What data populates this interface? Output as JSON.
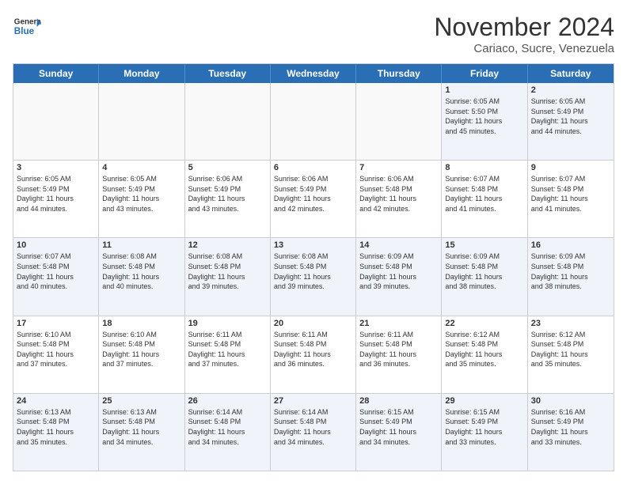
{
  "logo": {
    "general": "General",
    "blue": "Blue"
  },
  "title": "November 2024",
  "subtitle": "Cariaco, Sucre, Venezuela",
  "days": [
    "Sunday",
    "Monday",
    "Tuesday",
    "Wednesday",
    "Thursday",
    "Friday",
    "Saturday"
  ],
  "rows": [
    [
      {
        "day": "",
        "info": ""
      },
      {
        "day": "",
        "info": ""
      },
      {
        "day": "",
        "info": ""
      },
      {
        "day": "",
        "info": ""
      },
      {
        "day": "",
        "info": ""
      },
      {
        "day": "1",
        "info": "Sunrise: 6:05 AM\nSunset: 5:50 PM\nDaylight: 11 hours\nand 45 minutes."
      },
      {
        "day": "2",
        "info": "Sunrise: 6:05 AM\nSunset: 5:49 PM\nDaylight: 11 hours\nand 44 minutes."
      }
    ],
    [
      {
        "day": "3",
        "info": "Sunrise: 6:05 AM\nSunset: 5:49 PM\nDaylight: 11 hours\nand 44 minutes."
      },
      {
        "day": "4",
        "info": "Sunrise: 6:05 AM\nSunset: 5:49 PM\nDaylight: 11 hours\nand 43 minutes."
      },
      {
        "day": "5",
        "info": "Sunrise: 6:06 AM\nSunset: 5:49 PM\nDaylight: 11 hours\nand 43 minutes."
      },
      {
        "day": "6",
        "info": "Sunrise: 6:06 AM\nSunset: 5:49 PM\nDaylight: 11 hours\nand 42 minutes."
      },
      {
        "day": "7",
        "info": "Sunrise: 6:06 AM\nSunset: 5:48 PM\nDaylight: 11 hours\nand 42 minutes."
      },
      {
        "day": "8",
        "info": "Sunrise: 6:07 AM\nSunset: 5:48 PM\nDaylight: 11 hours\nand 41 minutes."
      },
      {
        "day": "9",
        "info": "Sunrise: 6:07 AM\nSunset: 5:48 PM\nDaylight: 11 hours\nand 41 minutes."
      }
    ],
    [
      {
        "day": "10",
        "info": "Sunrise: 6:07 AM\nSunset: 5:48 PM\nDaylight: 11 hours\nand 40 minutes."
      },
      {
        "day": "11",
        "info": "Sunrise: 6:08 AM\nSunset: 5:48 PM\nDaylight: 11 hours\nand 40 minutes."
      },
      {
        "day": "12",
        "info": "Sunrise: 6:08 AM\nSunset: 5:48 PM\nDaylight: 11 hours\nand 39 minutes."
      },
      {
        "day": "13",
        "info": "Sunrise: 6:08 AM\nSunset: 5:48 PM\nDaylight: 11 hours\nand 39 minutes."
      },
      {
        "day": "14",
        "info": "Sunrise: 6:09 AM\nSunset: 5:48 PM\nDaylight: 11 hours\nand 39 minutes."
      },
      {
        "day": "15",
        "info": "Sunrise: 6:09 AM\nSunset: 5:48 PM\nDaylight: 11 hours\nand 38 minutes."
      },
      {
        "day": "16",
        "info": "Sunrise: 6:09 AM\nSunset: 5:48 PM\nDaylight: 11 hours\nand 38 minutes."
      }
    ],
    [
      {
        "day": "17",
        "info": "Sunrise: 6:10 AM\nSunset: 5:48 PM\nDaylight: 11 hours\nand 37 minutes."
      },
      {
        "day": "18",
        "info": "Sunrise: 6:10 AM\nSunset: 5:48 PM\nDaylight: 11 hours\nand 37 minutes."
      },
      {
        "day": "19",
        "info": "Sunrise: 6:11 AM\nSunset: 5:48 PM\nDaylight: 11 hours\nand 37 minutes."
      },
      {
        "day": "20",
        "info": "Sunrise: 6:11 AM\nSunset: 5:48 PM\nDaylight: 11 hours\nand 36 minutes."
      },
      {
        "day": "21",
        "info": "Sunrise: 6:11 AM\nSunset: 5:48 PM\nDaylight: 11 hours\nand 36 minutes."
      },
      {
        "day": "22",
        "info": "Sunrise: 6:12 AM\nSunset: 5:48 PM\nDaylight: 11 hours\nand 35 minutes."
      },
      {
        "day": "23",
        "info": "Sunrise: 6:12 AM\nSunset: 5:48 PM\nDaylight: 11 hours\nand 35 minutes."
      }
    ],
    [
      {
        "day": "24",
        "info": "Sunrise: 6:13 AM\nSunset: 5:48 PM\nDaylight: 11 hours\nand 35 minutes."
      },
      {
        "day": "25",
        "info": "Sunrise: 6:13 AM\nSunset: 5:48 PM\nDaylight: 11 hours\nand 34 minutes."
      },
      {
        "day": "26",
        "info": "Sunrise: 6:14 AM\nSunset: 5:48 PM\nDaylight: 11 hours\nand 34 minutes."
      },
      {
        "day": "27",
        "info": "Sunrise: 6:14 AM\nSunset: 5:48 PM\nDaylight: 11 hours\nand 34 minutes."
      },
      {
        "day": "28",
        "info": "Sunrise: 6:15 AM\nSunset: 5:49 PM\nDaylight: 11 hours\nand 34 minutes."
      },
      {
        "day": "29",
        "info": "Sunrise: 6:15 AM\nSunset: 5:49 PM\nDaylight: 11 hours\nand 33 minutes."
      },
      {
        "day": "30",
        "info": "Sunrise: 6:16 AM\nSunset: 5:49 PM\nDaylight: 11 hours\nand 33 minutes."
      }
    ]
  ]
}
